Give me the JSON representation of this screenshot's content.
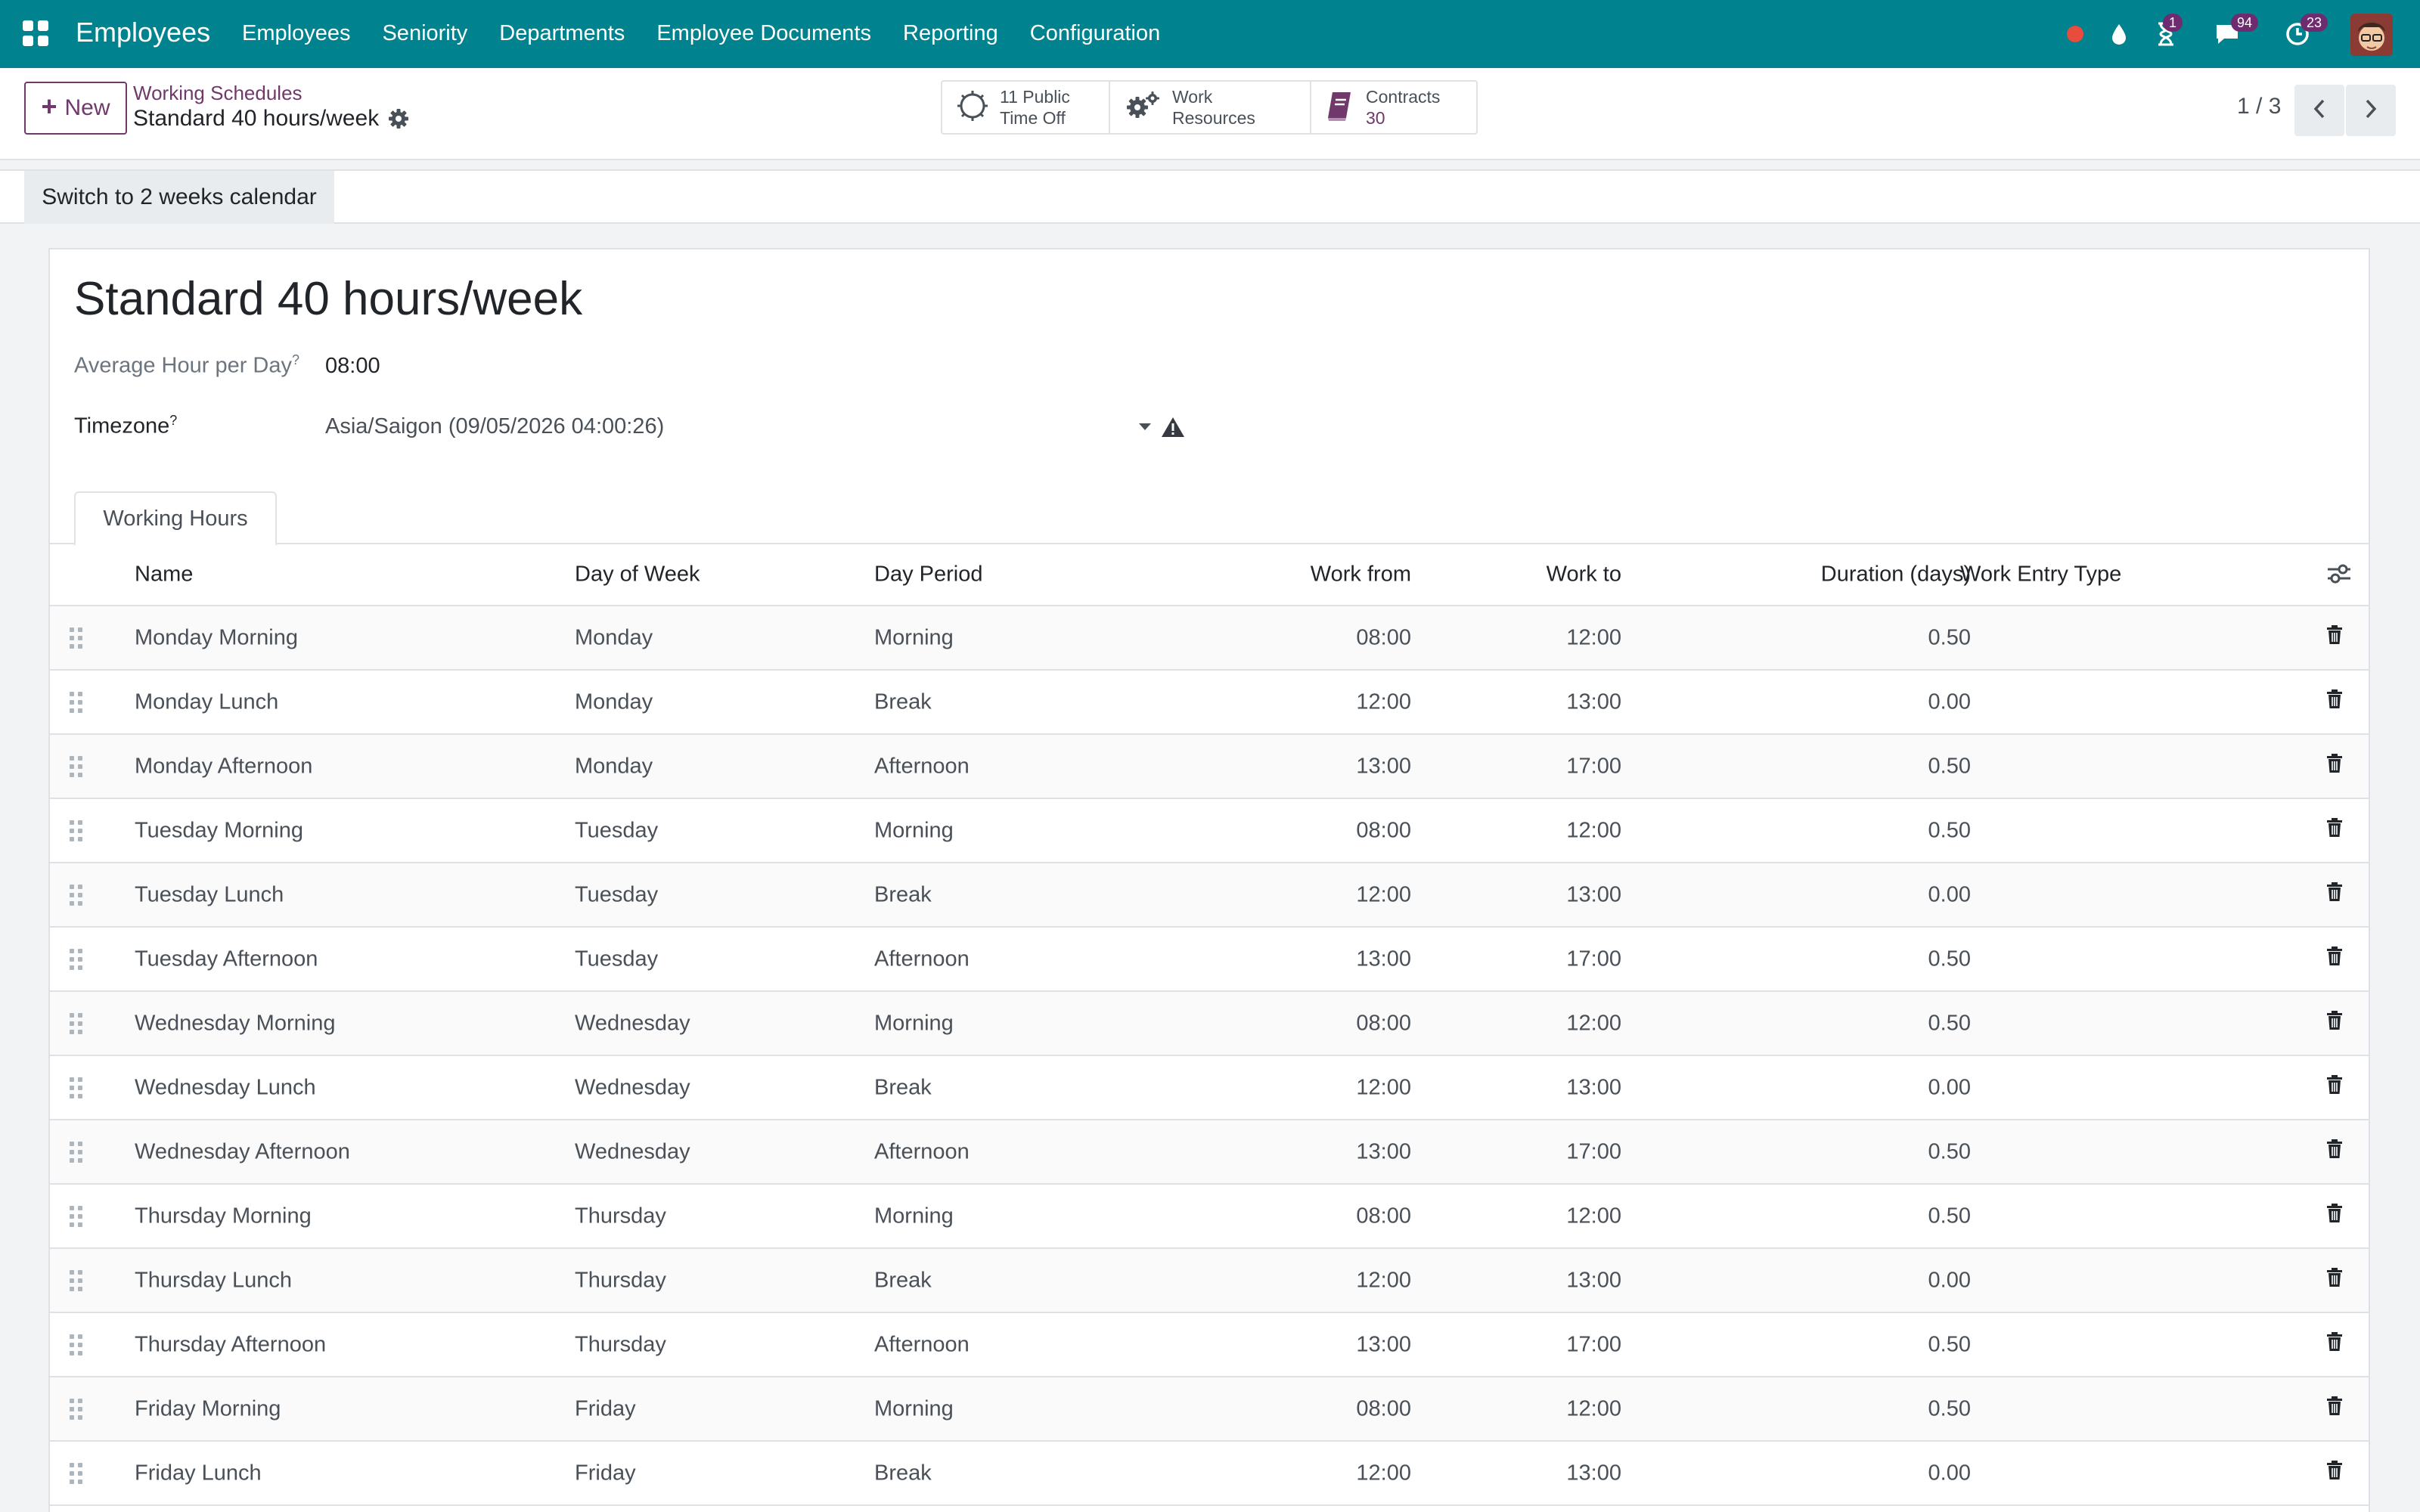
{
  "navbar": {
    "app_name": "Employees",
    "menu": [
      "Employees",
      "Seniority",
      "Departments",
      "Employee Documents",
      "Reporting",
      "Configuration"
    ],
    "activity_count": "1",
    "messages_count": "94",
    "clock_count": "23",
    "colors": {
      "bar": "#00838f",
      "badge": "#6f2b6f",
      "recording_dot": "#e74c3c"
    }
  },
  "control_panel": {
    "new_label": "New",
    "breadcrumb": "Working Schedules",
    "record_title": "Standard 40 hours/week",
    "smart_buttons": {
      "public_time_off_count": "11 Public",
      "public_time_off_label": "Time Off",
      "work_resources_label": "Work Resources",
      "contracts_label": "Contracts",
      "contracts_count": "30"
    },
    "pager": "1 / 3"
  },
  "statusbar": {
    "switch_label": "Switch to 2 weeks calendar"
  },
  "form": {
    "title": "Standard 40 hours/week",
    "avg_hour_label": "Average Hour per Day",
    "avg_hour_help": "?",
    "avg_hour_value": "08:00",
    "timezone_label": "Timezone",
    "timezone_help": "?",
    "timezone_value": "Asia/Saigon (09/05/2026 04:00:26)"
  },
  "tabs": {
    "working_hours": "Working Hours"
  },
  "table": {
    "headers": {
      "name": "Name",
      "day": "Day of Week",
      "period": "Day Period",
      "from": "Work from",
      "to": "Work to",
      "duration": "Duration (days)",
      "entry_type": "Work Entry Type"
    },
    "rows": [
      {
        "name": "Monday Morning",
        "day": "Monday",
        "period": "Morning",
        "from": "08:00",
        "to": "12:00",
        "duration": "0.50"
      },
      {
        "name": "Monday Lunch",
        "day": "Monday",
        "period": "Break",
        "from": "12:00",
        "to": "13:00",
        "duration": "0.00"
      },
      {
        "name": "Monday Afternoon",
        "day": "Monday",
        "period": "Afternoon",
        "from": "13:00",
        "to": "17:00",
        "duration": "0.50"
      },
      {
        "name": "Tuesday Morning",
        "day": "Tuesday",
        "period": "Morning",
        "from": "08:00",
        "to": "12:00",
        "duration": "0.50"
      },
      {
        "name": "Tuesday Lunch",
        "day": "Tuesday",
        "period": "Break",
        "from": "12:00",
        "to": "13:00",
        "duration": "0.00"
      },
      {
        "name": "Tuesday Afternoon",
        "day": "Tuesday",
        "period": "Afternoon",
        "from": "13:00",
        "to": "17:00",
        "duration": "0.50"
      },
      {
        "name": "Wednesday Morning",
        "day": "Wednesday",
        "period": "Morning",
        "from": "08:00",
        "to": "12:00",
        "duration": "0.50"
      },
      {
        "name": "Wednesday Lunch",
        "day": "Wednesday",
        "period": "Break",
        "from": "12:00",
        "to": "13:00",
        "duration": "0.00"
      },
      {
        "name": "Wednesday Afternoon",
        "day": "Wednesday",
        "period": "Afternoon",
        "from": "13:00",
        "to": "17:00",
        "duration": "0.50"
      },
      {
        "name": "Thursday Morning",
        "day": "Thursday",
        "period": "Morning",
        "from": "08:00",
        "to": "12:00",
        "duration": "0.50"
      },
      {
        "name": "Thursday Lunch",
        "day": "Thursday",
        "period": "Break",
        "from": "12:00",
        "to": "13:00",
        "duration": "0.00"
      },
      {
        "name": "Thursday Afternoon",
        "day": "Thursday",
        "period": "Afternoon",
        "from": "13:00",
        "to": "17:00",
        "duration": "0.50"
      },
      {
        "name": "Friday Morning",
        "day": "Friday",
        "period": "Morning",
        "from": "08:00",
        "to": "12:00",
        "duration": "0.50"
      },
      {
        "name": "Friday Lunch",
        "day": "Friday",
        "period": "Break",
        "from": "12:00",
        "to": "13:00",
        "duration": "0.00"
      }
    ]
  }
}
